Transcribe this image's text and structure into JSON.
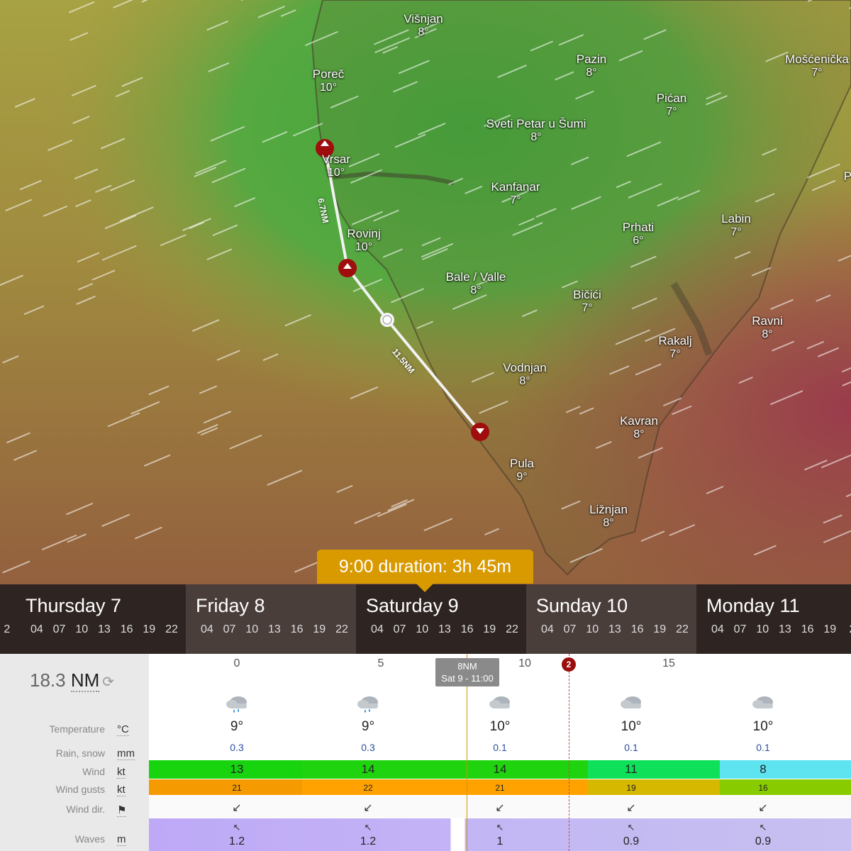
{
  "map": {
    "cities": [
      {
        "name": "Višnjan",
        "temp": "8°"
      },
      {
        "name": "Pazin",
        "temp": "8°"
      },
      {
        "name": "Mošćenička",
        "temp": "7°"
      },
      {
        "name": "Poreč",
        "temp": "10°"
      },
      {
        "name": "Pićan",
        "temp": "7°"
      },
      {
        "name": "Sveti Petar u Šumi",
        "temp": "8°"
      },
      {
        "name": "Vrsar",
        "temp": "10°"
      },
      {
        "name": "Kanfanar",
        "temp": "7°"
      },
      {
        "name": "Labin",
        "temp": "7°"
      },
      {
        "name": "Prhati",
        "temp": "6°"
      },
      {
        "name": "Rovinj",
        "temp": "10°"
      },
      {
        "name": "Bale / Valle",
        "temp": "8°"
      },
      {
        "name": "Bičići",
        "temp": "7°"
      },
      {
        "name": "Ravni",
        "temp": "8°"
      },
      {
        "name": "Rakalj",
        "temp": "7°"
      },
      {
        "name": "Vodnjan",
        "temp": "8°"
      },
      {
        "name": "Kavran",
        "temp": "8°"
      },
      {
        "name": "Pula",
        "temp": "9°"
      },
      {
        "name": "Ližnjan",
        "temp": "8°"
      }
    ],
    "partial_label": "Po",
    "waypoints": [
      "1",
      "2",
      "3"
    ],
    "segments": [
      "6.7NM",
      "11.5NM"
    ],
    "colors": {
      "route": "#f2f2f2",
      "waypoint": "#a00d0d"
    }
  },
  "duration_label": "9:00 duration: 3h 45m",
  "timeline": {
    "days": [
      {
        "name": "",
        "hours": [
          "2"
        ]
      },
      {
        "name": "Thursday 7",
        "hours": [
          "04",
          "07",
          "10",
          "13",
          "16",
          "19",
          "22"
        ]
      },
      {
        "name": "Friday 8",
        "hours": [
          "04",
          "07",
          "10",
          "13",
          "16",
          "19",
          "22"
        ]
      },
      {
        "name": "Saturday 9",
        "hours": [
          "04",
          "07",
          "10",
          "13",
          "16",
          "19",
          "22"
        ]
      },
      {
        "name": "Sunday 10",
        "hours": [
          "04",
          "07",
          "10",
          "13",
          "16",
          "19",
          "22"
        ]
      },
      {
        "name": "Monday 11",
        "hours": [
          "04",
          "07",
          "10",
          "13",
          "16",
          "19",
          "2"
        ]
      }
    ]
  },
  "route_table": {
    "total_distance": "18.3",
    "total_unit": "NM",
    "distance_ticks": [
      "0",
      "5",
      "10",
      "15"
    ],
    "current_marker": {
      "distance": "8NM",
      "time": "Sat 9 - 11:00"
    },
    "waypoint_marker": "2",
    "rows": [
      {
        "label": "Temperature",
        "unit": "°C"
      },
      {
        "label": "Rain, snow",
        "unit": "mm"
      },
      {
        "label": "Wind",
        "unit": "kt"
      },
      {
        "label": "Wind gusts",
        "unit": "kt"
      },
      {
        "label": "Wind dir.",
        "unit": "⚑"
      },
      {
        "label": "Waves",
        "unit": "m"
      }
    ],
    "columns": [
      {
        "icon": "rain-cloud-icon",
        "temp": "9°",
        "rain": "0.3",
        "wind": "13",
        "gust": "21",
        "dir": "↙",
        "wave_dir": "↖",
        "wave": "1.2"
      },
      {
        "icon": "rain-cloud-icon",
        "temp": "9°",
        "rain": "0.3",
        "wind": "14",
        "gust": "22",
        "dir": "↙",
        "wave_dir": "↖",
        "wave": "1.2"
      },
      {
        "icon": "cloud-icon",
        "temp": "10°",
        "rain": "0.1",
        "wind": "14",
        "gust": "21",
        "dir": "↙",
        "wave_dir": "↖",
        "wave": "1"
      },
      {
        "icon": "cloud-icon",
        "temp": "10°",
        "rain": "0.1",
        "wind": "11",
        "gust": "19",
        "dir": "↙",
        "wave_dir": "↖",
        "wave": "0.9"
      },
      {
        "icon": "cloud-icon",
        "temp": "10°",
        "rain": "0.1",
        "wind": "8",
        "gust": "16",
        "dir": "↙",
        "wave_dir": "↖",
        "wave": "0.9"
      }
    ],
    "colors": {
      "wind": [
        "#17d40f",
        "#1fd40f",
        "#1fd40f",
        "#0fe05a",
        "#5ee3f0"
      ],
      "gust": [
        "#f59a00",
        "#ffa200",
        "#ffa200",
        "#d6b800",
        "#88cc00"
      ],
      "wave": "#c0b0f5",
      "current_line": "#d19500"
    }
  }
}
